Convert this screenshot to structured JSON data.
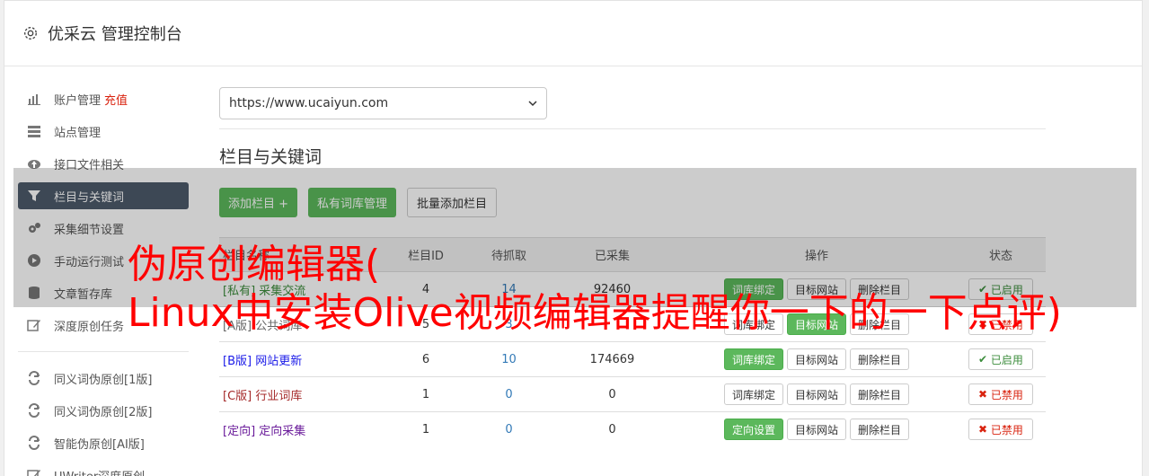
{
  "header": {
    "title": "优采云 管理控制台",
    "icon": "gear-icon"
  },
  "sidebar": {
    "items": [
      {
        "label": "账户管理",
        "extra": "充值",
        "icon": "bar-chart-icon"
      },
      {
        "label": "站点管理",
        "icon": "server-icon"
      },
      {
        "label": "接口文件相关",
        "icon": "cloud-upload-icon"
      },
      {
        "label": "栏目与关键词",
        "icon": "filter-icon",
        "active": true
      },
      {
        "label": "采集细节设置",
        "icon": "cogs-icon"
      },
      {
        "label": "手动运行测试",
        "icon": "play-circle-icon"
      },
      {
        "label": "文章暂存库",
        "icon": "database-icon"
      },
      {
        "label": "深度原创任务",
        "icon": "edit-icon"
      }
    ],
    "items2": [
      {
        "label": "同义词伪原创[1版]",
        "icon": "refresh-icon"
      },
      {
        "label": "同义词伪原创[2版]",
        "icon": "refresh-icon"
      },
      {
        "label": "智能伪原创[AI版]",
        "icon": "refresh-icon"
      },
      {
        "label": "UWriter深度原创",
        "icon": "edit-icon"
      }
    ]
  },
  "main": {
    "site_select": "https://www.ucaiyun.com",
    "section_title": "栏目与关键词",
    "buttons": {
      "add": "添加栏目 +",
      "private_lib": "私有词库管理",
      "batch_add": "批量添加栏目"
    },
    "table": {
      "headers": [
        "栏目名称",
        "栏目ID",
        "待抓取",
        "已采集",
        "操作",
        "状态"
      ],
      "rows": [
        {
          "tag": "[私有]",
          "name": "采集交流",
          "id": "4",
          "pending": "14",
          "collected": "92460",
          "bind": "词库绑定",
          "site": "目标网站",
          "del": "删除栏目",
          "status": "已启用"
        },
        {
          "tag": "[A版]",
          "name": "公共词库",
          "id": "5",
          "pending": "3",
          "collected": "",
          "bind": "词库绑定",
          "site": "目标网站",
          "del": "删除栏目",
          "status": "已禁用"
        },
        {
          "tag": "[B版]",
          "name": "网站更新",
          "id": "6",
          "pending": "10",
          "collected": "174669",
          "bind": "词库绑定",
          "site": "目标网站",
          "del": "删除栏目",
          "status": "已启用"
        },
        {
          "tag": "[C版]",
          "name": "行业词库",
          "id": "1",
          "pending": "0",
          "collected": "0",
          "bind": "词库绑定",
          "site": "目标网站",
          "del": "删除栏目",
          "status": "已禁用"
        },
        {
          "tag": "[定向]",
          "name": "定向采集",
          "id": "1",
          "pending": "0",
          "collected": "0",
          "bind": "定向设置",
          "site": "目标网站",
          "del": "删除栏目",
          "status": "已禁用"
        }
      ]
    }
  },
  "watermark": {
    "line1": "伪原创编辑器(",
    "line2": "Linux中安装Olive视频编辑器提醒你一下的一下点评)"
  },
  "colors": {
    "accent_green": "#5cb85c",
    "sidebar_active": "#4d5a6b",
    "watermark": "#ff0000"
  }
}
